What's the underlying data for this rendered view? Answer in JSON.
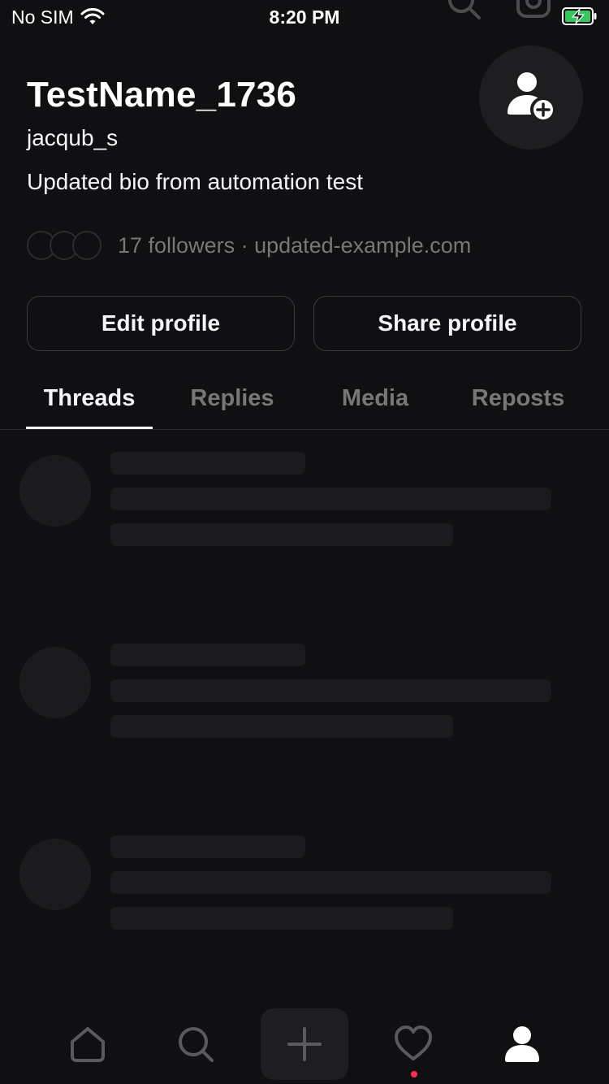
{
  "status_bar": {
    "carrier": "No SIM",
    "time": "8:20 PM",
    "carrier_icon": "wifi-icon",
    "battery_icon": "battery-charging-icon"
  },
  "profile": {
    "name": "TestName_1736",
    "handle": "jacqub_s",
    "bio": "Updated bio from automation test",
    "followers_text": "17 followers · updated-example.com",
    "avatar_icon": "add-user-icon"
  },
  "actions": {
    "edit_label": "Edit profile",
    "share_label": "Share profile"
  },
  "tabs": [
    {
      "label": "Threads",
      "active": true
    },
    {
      "label": "Replies",
      "active": false
    },
    {
      "label": "Media",
      "active": false
    },
    {
      "label": "Reposts",
      "active": false
    }
  ],
  "nav": {
    "items": [
      "home-icon",
      "search-icon",
      "plus-icon",
      "heart-icon",
      "profile-icon"
    ],
    "active": "profile-icon",
    "has_activity_notification": true
  },
  "colors": {
    "background": "#101012",
    "text_primary": "#f3f5f7",
    "text_secondary": "#777777",
    "notification": "#ff2d4f",
    "battery_charge": "#34c759"
  }
}
